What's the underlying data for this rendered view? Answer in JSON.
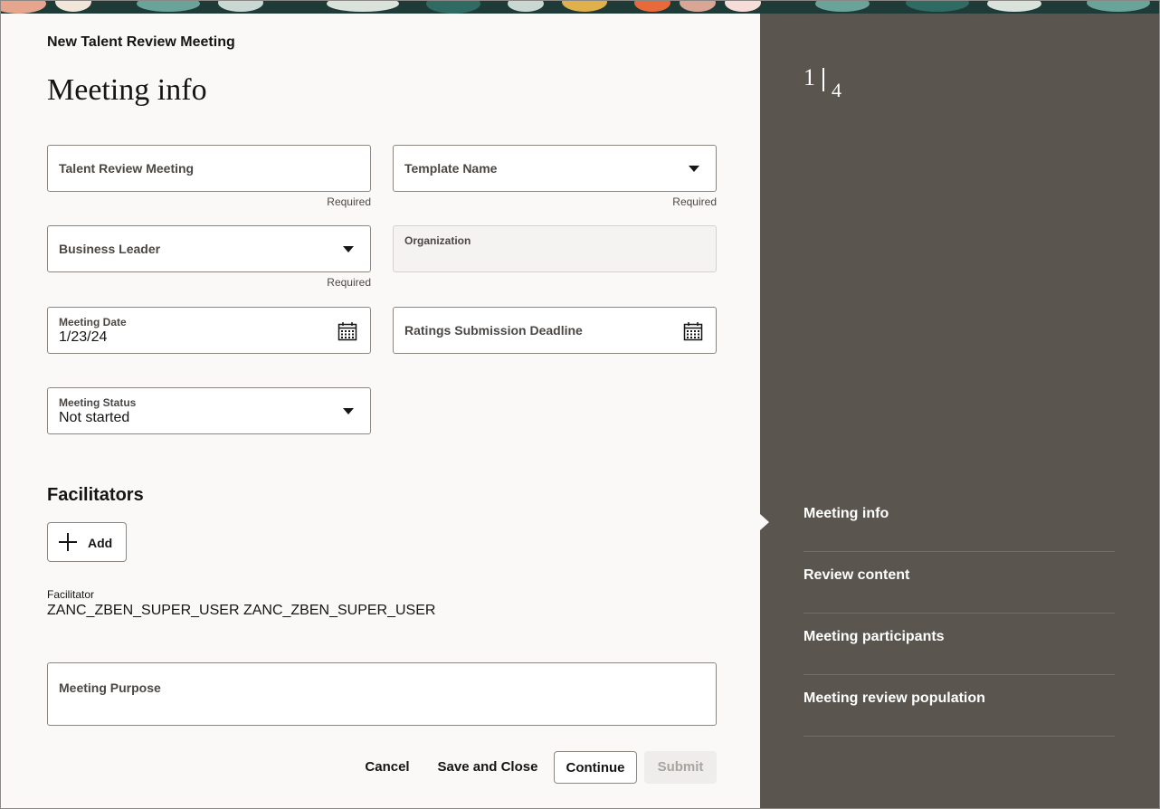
{
  "header": {
    "kicker": "New Talent Review Meeting",
    "title": "Meeting info"
  },
  "form": {
    "talent_review_meeting": {
      "placeholder": "Talent Review Meeting",
      "required": "Required"
    },
    "template_name": {
      "placeholder": "Template Name",
      "required": "Required"
    },
    "business_leader": {
      "placeholder": "Business Leader",
      "required": "Required"
    },
    "organization": {
      "label": "Organization"
    },
    "meeting_date": {
      "label": "Meeting Date",
      "value": "1/23/24"
    },
    "ratings_deadline": {
      "placeholder": "Ratings Submission Deadline"
    },
    "meeting_status": {
      "label": "Meeting Status",
      "value": "Not started"
    }
  },
  "facilitators": {
    "title": "Facilitators",
    "add_label": "Add",
    "field_label": "Facilitator",
    "value": "ZANC_ZBEN_SUPER_USER ZANC_ZBEN_SUPER_USER"
  },
  "purpose": {
    "placeholder": "Meeting Purpose"
  },
  "footer": {
    "cancel": "Cancel",
    "save_close": "Save and Close",
    "continue": "Continue",
    "submit": "Submit"
  },
  "progress": {
    "current": "1",
    "total": "4"
  },
  "steps": [
    {
      "label": "Meeting info",
      "active": true
    },
    {
      "label": "Review content"
    },
    {
      "label": "Meeting participants"
    },
    {
      "label": "Meeting review population"
    }
  ],
  "colors": {
    "panel": "#5b5550",
    "page": "#fbf9f8",
    "banner": "#1e3b37"
  },
  "icons": [
    "calendar-icon",
    "chevron-down-icon",
    "plus-icon"
  ]
}
